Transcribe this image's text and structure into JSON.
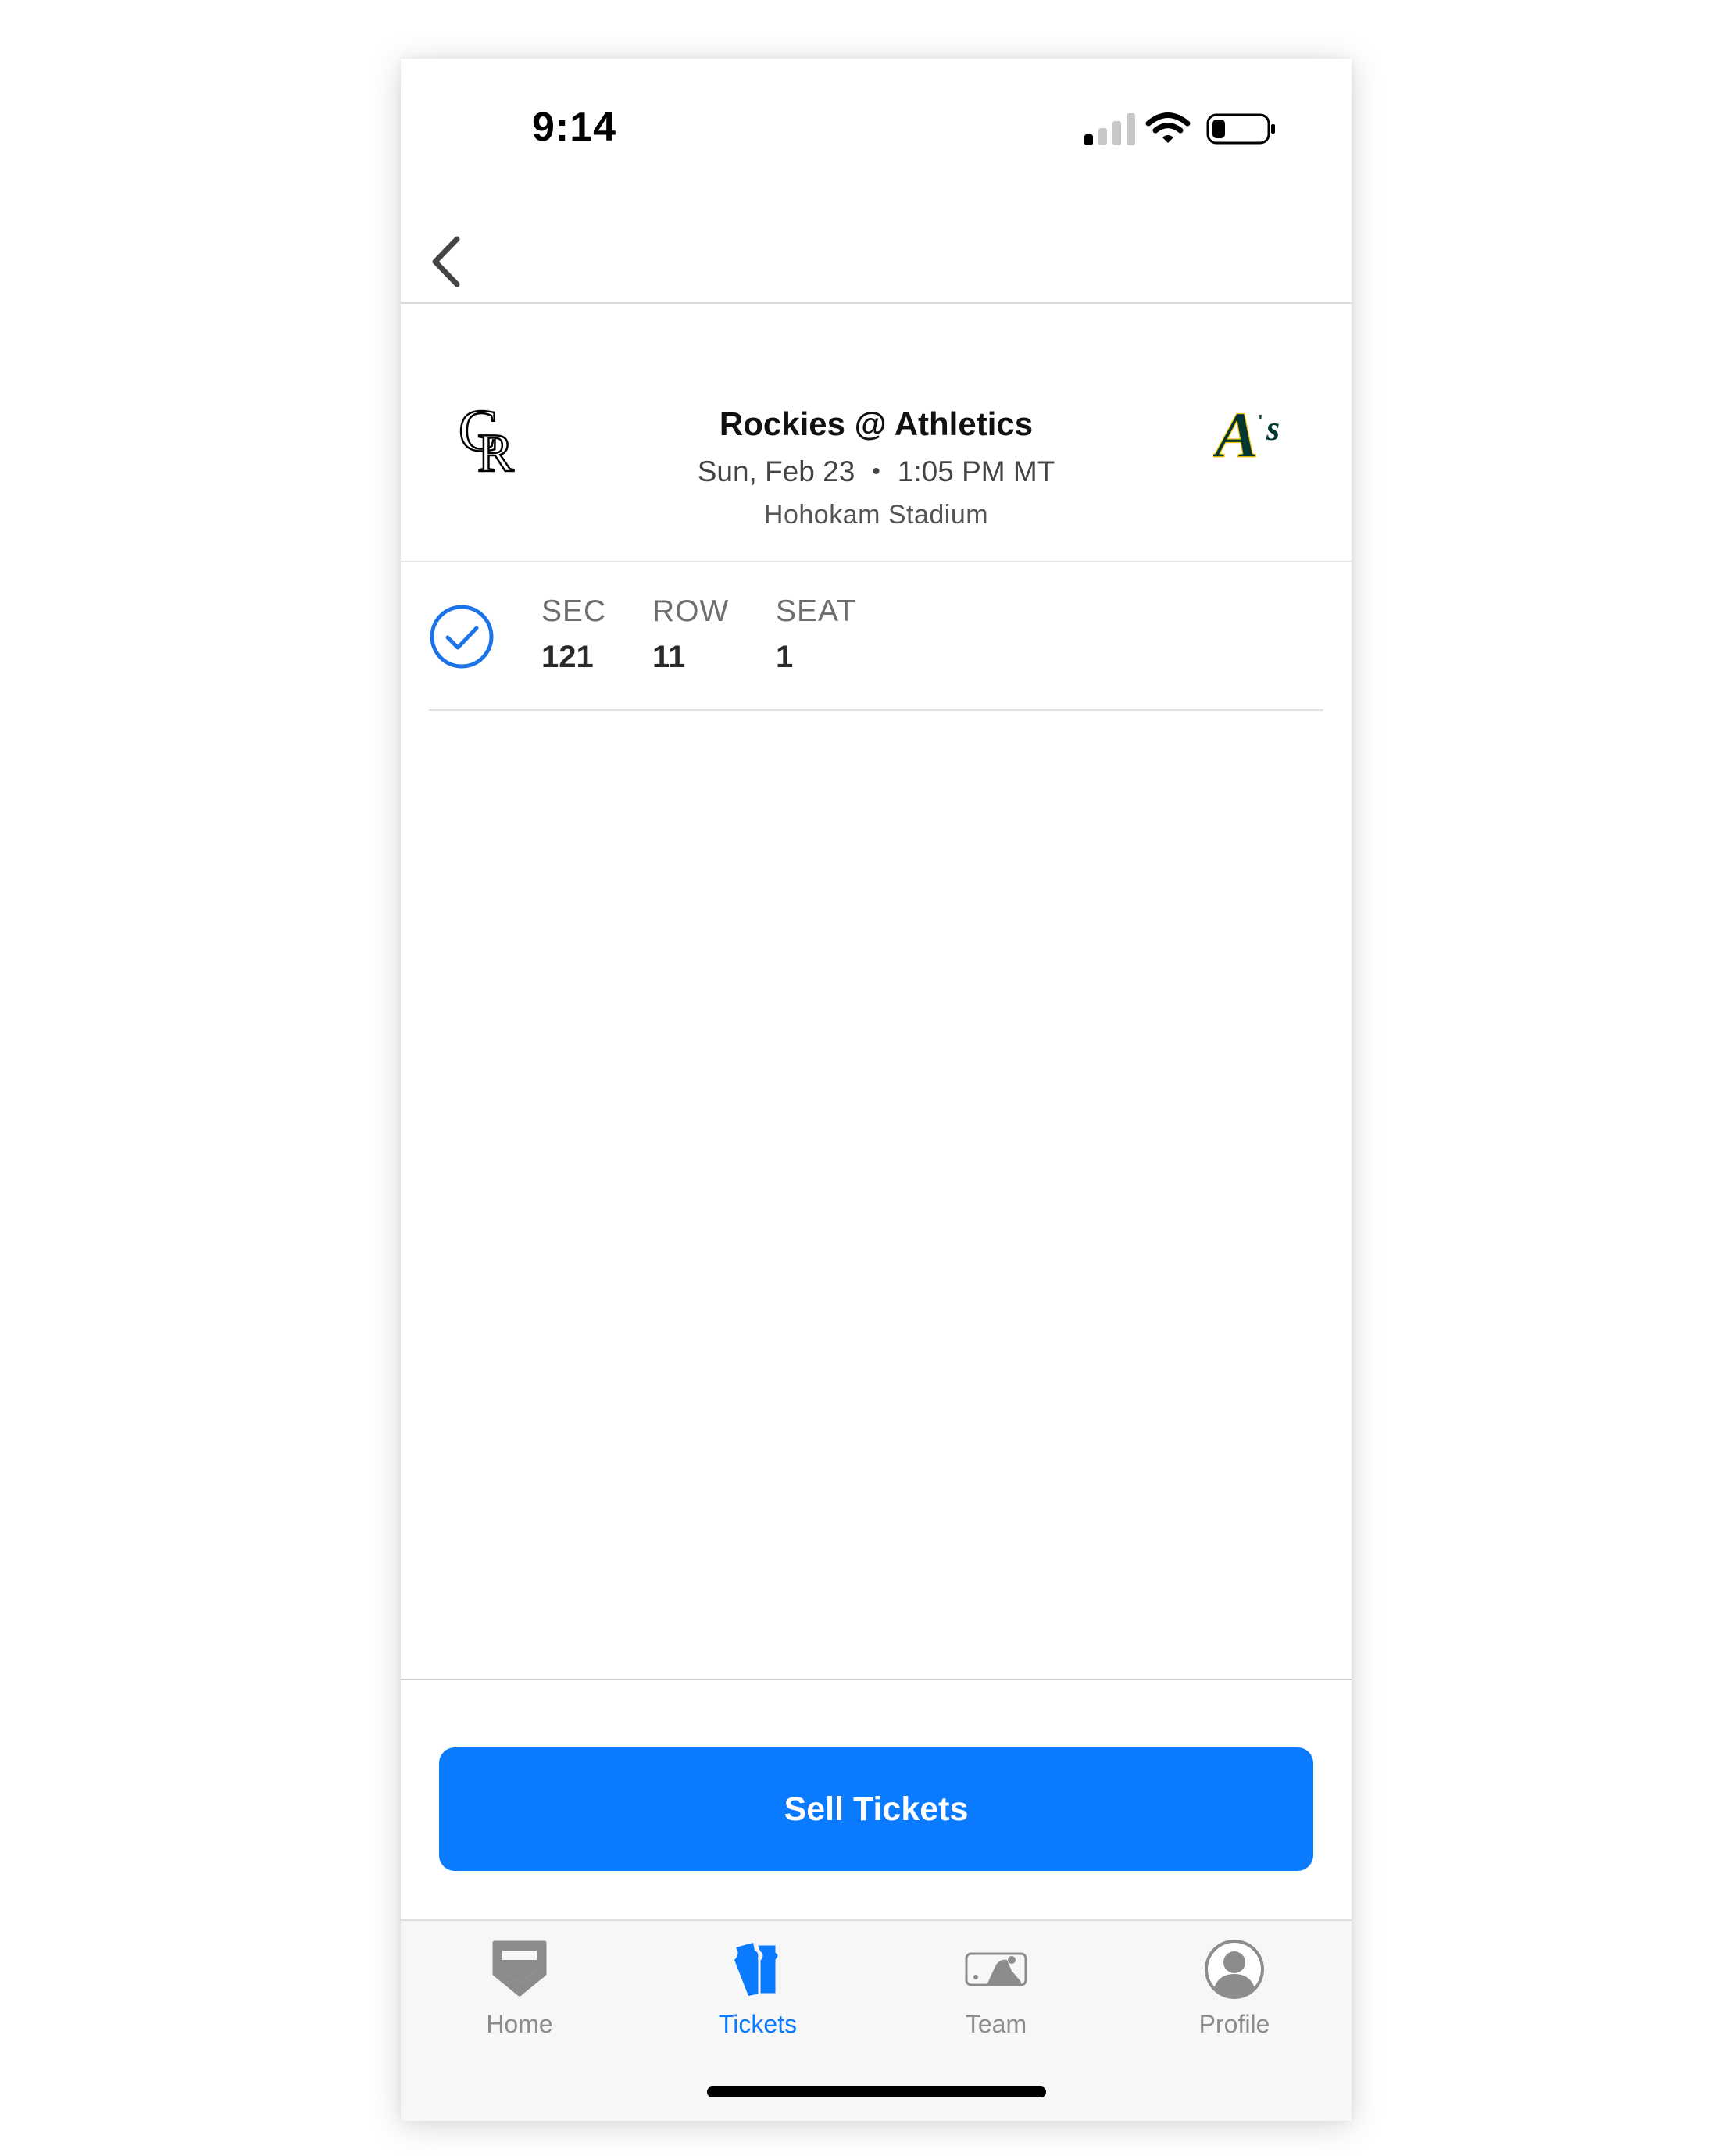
{
  "status_bar": {
    "time": "9:14",
    "icons": [
      "cellular-signal-icon",
      "wifi-icon",
      "battery-icon"
    ]
  },
  "nav": {
    "back_icon": "chevron-left-icon"
  },
  "game": {
    "title": "Rockies @ Athletics",
    "date": "Sun, Feb 23",
    "separator": "•",
    "time": "1:05 PM MT",
    "venue": "Hohokam Stadium",
    "away_team_logo": "rockies-logo",
    "home_team_logo": "athletics-logo"
  },
  "seat": {
    "selected": true,
    "section_label": "SEC",
    "section": "121",
    "row_label": "ROW",
    "row": "11",
    "seat_label": "SEAT",
    "seat": "1"
  },
  "actions": {
    "sell_label": "Sell Tickets"
  },
  "tabs": [
    {
      "label": "Home",
      "icon": "home-plate-icon",
      "active": false
    },
    {
      "label": "Tickets",
      "icon": "tickets-icon",
      "active": true
    },
    {
      "label": "Team",
      "icon": "team-logo-icon",
      "active": false
    },
    {
      "label": "Profile",
      "icon": "profile-icon",
      "active": false
    }
  ],
  "colors": {
    "accent": "#0a7bff",
    "inactive_tab": "#8c8c8c",
    "athletics_green": "#003831",
    "check_blue": "#1a73e8"
  }
}
